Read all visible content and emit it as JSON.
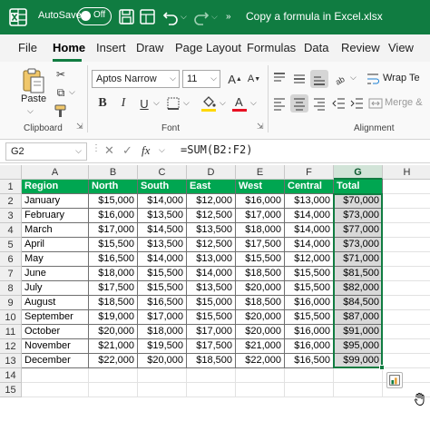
{
  "titlebar": {
    "autosave_label": "AutoSave",
    "autosave_state": "Off",
    "filename": "Copy a formula in Excel.xlsx"
  },
  "menu": {
    "tabs": [
      "File",
      "Home",
      "Insert",
      "Draw",
      "Page Layout",
      "Formulas",
      "Data",
      "Review",
      "View"
    ],
    "active_tab": "Home"
  },
  "ribbon": {
    "clipboard": {
      "paste_label": "Paste",
      "group_label": "Clipboard"
    },
    "font": {
      "font_name": "Aptos Narrow",
      "font_size": "11",
      "group_label": "Font"
    },
    "alignment": {
      "wrap_label": "Wrap Te",
      "merge_label": "Merge &",
      "group_label": "Alignment"
    }
  },
  "formula_bar": {
    "name_box": "G2",
    "formula": "=SUM(B2:F2)"
  },
  "sheet": {
    "columns": [
      "A",
      "B",
      "C",
      "D",
      "E",
      "F",
      "G",
      "H"
    ],
    "selected_column": "G",
    "row_numbers": [
      "1",
      "2",
      "3",
      "4",
      "5",
      "6",
      "7",
      "8",
      "9",
      "10",
      "11",
      "12",
      "13",
      "14",
      "15"
    ],
    "headers": [
      "Region",
      "North",
      "South",
      "East",
      "West",
      "Central",
      "Total"
    ],
    "rows": [
      [
        "January",
        "$15,000",
        "$14,000",
        "$12,000",
        "$16,000",
        "$13,000",
        "$70,000"
      ],
      [
        "February",
        "$16,000",
        "$13,500",
        "$12,500",
        "$17,000",
        "$14,000",
        "$73,000"
      ],
      [
        "March",
        "$17,000",
        "$14,500",
        "$13,500",
        "$18,000",
        "$14,000",
        "$77,000"
      ],
      [
        "April",
        "$15,500",
        "$13,500",
        "$12,500",
        "$17,500",
        "$14,000",
        "$73,000"
      ],
      [
        "May",
        "$16,500",
        "$14,000",
        "$13,000",
        "$15,500",
        "$12,000",
        "$71,000"
      ],
      [
        "June",
        "$18,000",
        "$15,500",
        "$14,000",
        "$18,500",
        "$15,500",
        "$81,500"
      ],
      [
        "July",
        "$17,500",
        "$15,500",
        "$13,500",
        "$20,000",
        "$15,500",
        "$82,000"
      ],
      [
        "August",
        "$18,500",
        "$16,500",
        "$15,000",
        "$18,500",
        "$16,000",
        "$84,500"
      ],
      [
        "September",
        "$19,000",
        "$17,000",
        "$15,500",
        "$20,000",
        "$15,500",
        "$87,000"
      ],
      [
        "October",
        "$20,000",
        "$18,000",
        "$17,000",
        "$20,000",
        "$16,000",
        "$91,000"
      ],
      [
        "November",
        "$21,000",
        "$19,500",
        "$17,500",
        "$21,000",
        "$16,000",
        "$95,000"
      ],
      [
        "December",
        "$22,000",
        "$20,000",
        "$18,500",
        "$22,000",
        "$16,500",
        "$99,000"
      ]
    ]
  },
  "colors": {
    "excel_green": "#107c41",
    "header_fill": "#00a651",
    "total_fill": "#d9d9d9"
  },
  "icons": [
    "excel-logo-icon",
    "save-icon",
    "undo-icon",
    "redo-icon",
    "paste-icon",
    "cut-icon",
    "copy-icon",
    "format-painter-icon",
    "bold-icon",
    "italic-icon",
    "underline-icon",
    "borders-icon",
    "fill-color-icon",
    "font-color-icon",
    "wrap-text-icon",
    "merge-icon",
    "quick-analysis-icon",
    "cursor-icon"
  ]
}
